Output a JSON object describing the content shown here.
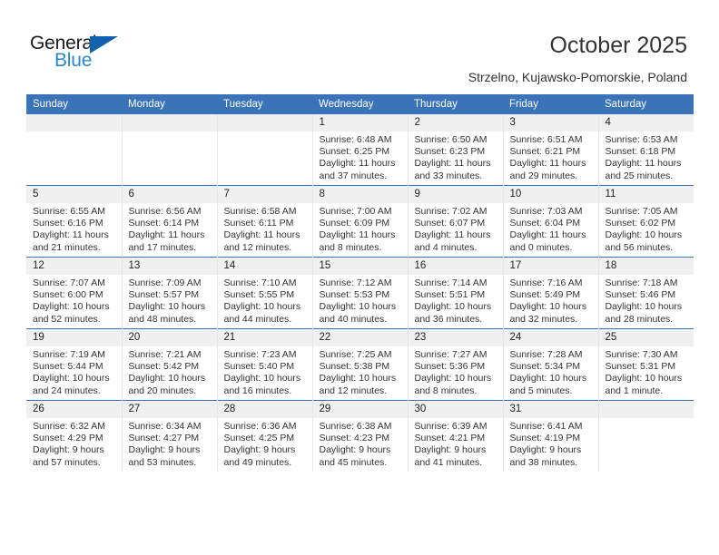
{
  "brand": {
    "name_top": "General",
    "name_bottom": "Blue",
    "accent_color": "#2a87d0",
    "triangle_color": "#1162ad"
  },
  "header": {
    "title": "October 2025",
    "subtitle": "Strzelno, Kujawsko-Pomorskie, Poland",
    "header_bg": "#3a73b8"
  },
  "calendar": {
    "weekday_headers": [
      "Sunday",
      "Monday",
      "Tuesday",
      "Wednesday",
      "Thursday",
      "Friday",
      "Saturday"
    ],
    "weeks": [
      [
        {
          "day": "",
          "lines": []
        },
        {
          "day": "",
          "lines": []
        },
        {
          "day": "",
          "lines": []
        },
        {
          "day": "1",
          "lines": [
            "Sunrise: 6:48 AM",
            "Sunset: 6:25 PM",
            "Daylight: 11 hours",
            "and 37 minutes."
          ]
        },
        {
          "day": "2",
          "lines": [
            "Sunrise: 6:50 AM",
            "Sunset: 6:23 PM",
            "Daylight: 11 hours",
            "and 33 minutes."
          ]
        },
        {
          "day": "3",
          "lines": [
            "Sunrise: 6:51 AM",
            "Sunset: 6:21 PM",
            "Daylight: 11 hours",
            "and 29 minutes."
          ]
        },
        {
          "day": "4",
          "lines": [
            "Sunrise: 6:53 AM",
            "Sunset: 6:18 PM",
            "Daylight: 11 hours",
            "and 25 minutes."
          ]
        }
      ],
      [
        {
          "day": "5",
          "lines": [
            "Sunrise: 6:55 AM",
            "Sunset: 6:16 PM",
            "Daylight: 11 hours",
            "and 21 minutes."
          ]
        },
        {
          "day": "6",
          "lines": [
            "Sunrise: 6:56 AM",
            "Sunset: 6:14 PM",
            "Daylight: 11 hours",
            "and 17 minutes."
          ]
        },
        {
          "day": "7",
          "lines": [
            "Sunrise: 6:58 AM",
            "Sunset: 6:11 PM",
            "Daylight: 11 hours",
            "and 12 minutes."
          ]
        },
        {
          "day": "8",
          "lines": [
            "Sunrise: 7:00 AM",
            "Sunset: 6:09 PM",
            "Daylight: 11 hours",
            "and 8 minutes."
          ]
        },
        {
          "day": "9",
          "lines": [
            "Sunrise: 7:02 AM",
            "Sunset: 6:07 PM",
            "Daylight: 11 hours",
            "and 4 minutes."
          ]
        },
        {
          "day": "10",
          "lines": [
            "Sunrise: 7:03 AM",
            "Sunset: 6:04 PM",
            "Daylight: 11 hours",
            "and 0 minutes."
          ]
        },
        {
          "day": "11",
          "lines": [
            "Sunrise: 7:05 AM",
            "Sunset: 6:02 PM",
            "Daylight: 10 hours",
            "and 56 minutes."
          ]
        }
      ],
      [
        {
          "day": "12",
          "lines": [
            "Sunrise: 7:07 AM",
            "Sunset: 6:00 PM",
            "Daylight: 10 hours",
            "and 52 minutes."
          ]
        },
        {
          "day": "13",
          "lines": [
            "Sunrise: 7:09 AM",
            "Sunset: 5:57 PM",
            "Daylight: 10 hours",
            "and 48 minutes."
          ]
        },
        {
          "day": "14",
          "lines": [
            "Sunrise: 7:10 AM",
            "Sunset: 5:55 PM",
            "Daylight: 10 hours",
            "and 44 minutes."
          ]
        },
        {
          "day": "15",
          "lines": [
            "Sunrise: 7:12 AM",
            "Sunset: 5:53 PM",
            "Daylight: 10 hours",
            "and 40 minutes."
          ]
        },
        {
          "day": "16",
          "lines": [
            "Sunrise: 7:14 AM",
            "Sunset: 5:51 PM",
            "Daylight: 10 hours",
            "and 36 minutes."
          ]
        },
        {
          "day": "17",
          "lines": [
            "Sunrise: 7:16 AM",
            "Sunset: 5:49 PM",
            "Daylight: 10 hours",
            "and 32 minutes."
          ]
        },
        {
          "day": "18",
          "lines": [
            "Sunrise: 7:18 AM",
            "Sunset: 5:46 PM",
            "Daylight: 10 hours",
            "and 28 minutes."
          ]
        }
      ],
      [
        {
          "day": "19",
          "lines": [
            "Sunrise: 7:19 AM",
            "Sunset: 5:44 PM",
            "Daylight: 10 hours",
            "and 24 minutes."
          ]
        },
        {
          "day": "20",
          "lines": [
            "Sunrise: 7:21 AM",
            "Sunset: 5:42 PM",
            "Daylight: 10 hours",
            "and 20 minutes."
          ]
        },
        {
          "day": "21",
          "lines": [
            "Sunrise: 7:23 AM",
            "Sunset: 5:40 PM",
            "Daylight: 10 hours",
            "and 16 minutes."
          ]
        },
        {
          "day": "22",
          "lines": [
            "Sunrise: 7:25 AM",
            "Sunset: 5:38 PM",
            "Daylight: 10 hours",
            "and 12 minutes."
          ]
        },
        {
          "day": "23",
          "lines": [
            "Sunrise: 7:27 AM",
            "Sunset: 5:36 PM",
            "Daylight: 10 hours",
            "and 8 minutes."
          ]
        },
        {
          "day": "24",
          "lines": [
            "Sunrise: 7:28 AM",
            "Sunset: 5:34 PM",
            "Daylight: 10 hours",
            "and 5 minutes."
          ]
        },
        {
          "day": "25",
          "lines": [
            "Sunrise: 7:30 AM",
            "Sunset: 5:31 PM",
            "Daylight: 10 hours",
            "and 1 minute."
          ]
        }
      ],
      [
        {
          "day": "26",
          "lines": [
            "Sunrise: 6:32 AM",
            "Sunset: 4:29 PM",
            "Daylight: 9 hours",
            "and 57 minutes."
          ]
        },
        {
          "day": "27",
          "lines": [
            "Sunrise: 6:34 AM",
            "Sunset: 4:27 PM",
            "Daylight: 9 hours",
            "and 53 minutes."
          ]
        },
        {
          "day": "28",
          "lines": [
            "Sunrise: 6:36 AM",
            "Sunset: 4:25 PM",
            "Daylight: 9 hours",
            "and 49 minutes."
          ]
        },
        {
          "day": "29",
          "lines": [
            "Sunrise: 6:38 AM",
            "Sunset: 4:23 PM",
            "Daylight: 9 hours",
            "and 45 minutes."
          ]
        },
        {
          "day": "30",
          "lines": [
            "Sunrise: 6:39 AM",
            "Sunset: 4:21 PM",
            "Daylight: 9 hours",
            "and 41 minutes."
          ]
        },
        {
          "day": "31",
          "lines": [
            "Sunrise: 6:41 AM",
            "Sunset: 4:19 PM",
            "Daylight: 9 hours",
            "and 38 minutes."
          ]
        },
        {
          "day": "",
          "lines": []
        }
      ]
    ]
  }
}
